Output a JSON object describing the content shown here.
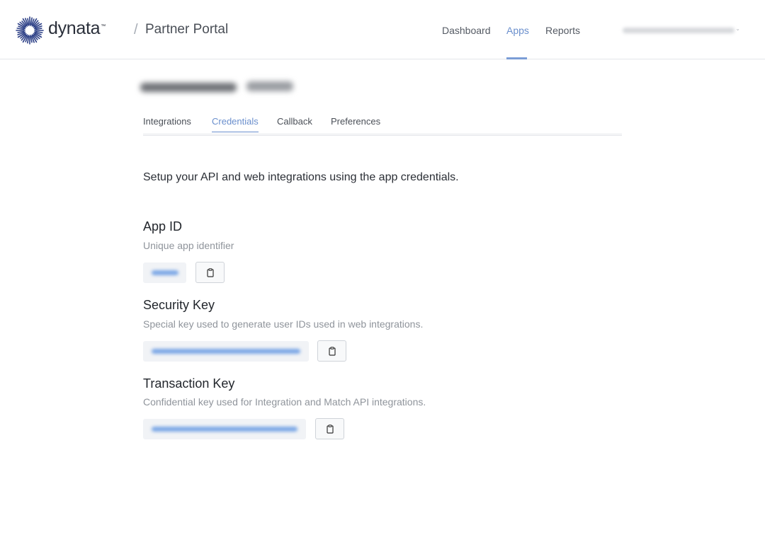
{
  "header": {
    "brand": "dynata",
    "brand_tm": "™",
    "separator": "/",
    "portal_title": "Partner Portal",
    "nav": {
      "dashboard": "Dashboard",
      "apps": "Apps",
      "reports": "Reports"
    },
    "active_nav": "Apps"
  },
  "tabs": {
    "integrations": "Integrations",
    "credentials": "Credentials",
    "callback": "Callback",
    "preferences": "Preferences",
    "active": "Credentials"
  },
  "intro": "Setup your API and web integrations using the app credentials.",
  "credentials": {
    "app_id": {
      "title": "App ID",
      "description": "Unique app identifier"
    },
    "security_key": {
      "title": "Security Key",
      "description": "Special key used to generate user IDs used in web integrations."
    },
    "transaction_key": {
      "title": "Transaction Key",
      "description": "Confidential key used for Integration and Match API integrations."
    }
  },
  "icons": {
    "logo": "dynata-sunburst-logo",
    "copy": "clipboard-icon",
    "user_menu": "chevron-down-icon"
  },
  "colors": {
    "accent": "#6a8fcd",
    "logo": "#2c3f86",
    "muted_text": "#8f949b"
  }
}
